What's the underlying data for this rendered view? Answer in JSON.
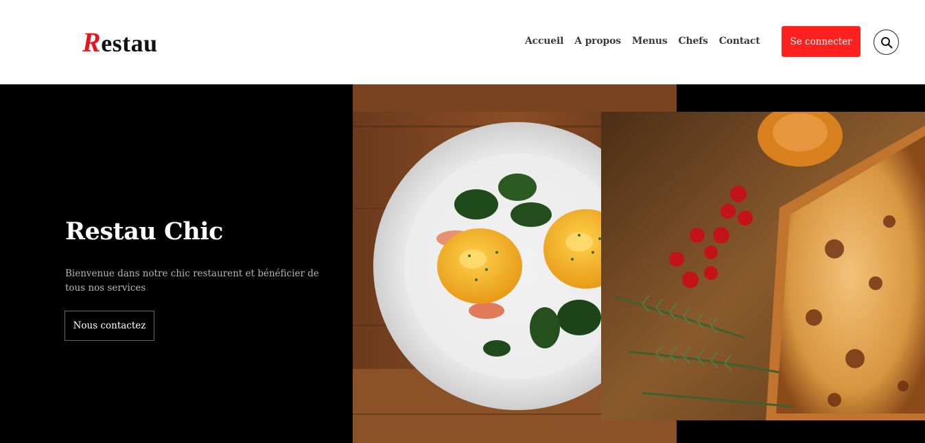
{
  "header": {
    "logo_initial": "R",
    "logo_rest": "estau",
    "nav": [
      "Accueil",
      "A propos",
      "Menus",
      "Chefs",
      "Contact"
    ],
    "login_label": "Se connecter",
    "search_icon": "search-icon"
  },
  "hero": {
    "title": "Restau Chic",
    "text": "Bienvenue dans notre chic restaurent et bénéficier de tous nos services",
    "cta_label": "Nous contactez"
  },
  "colors": {
    "accent": "#ff2020",
    "logo_red": "#e8141b",
    "hero_bg": "#000000"
  }
}
